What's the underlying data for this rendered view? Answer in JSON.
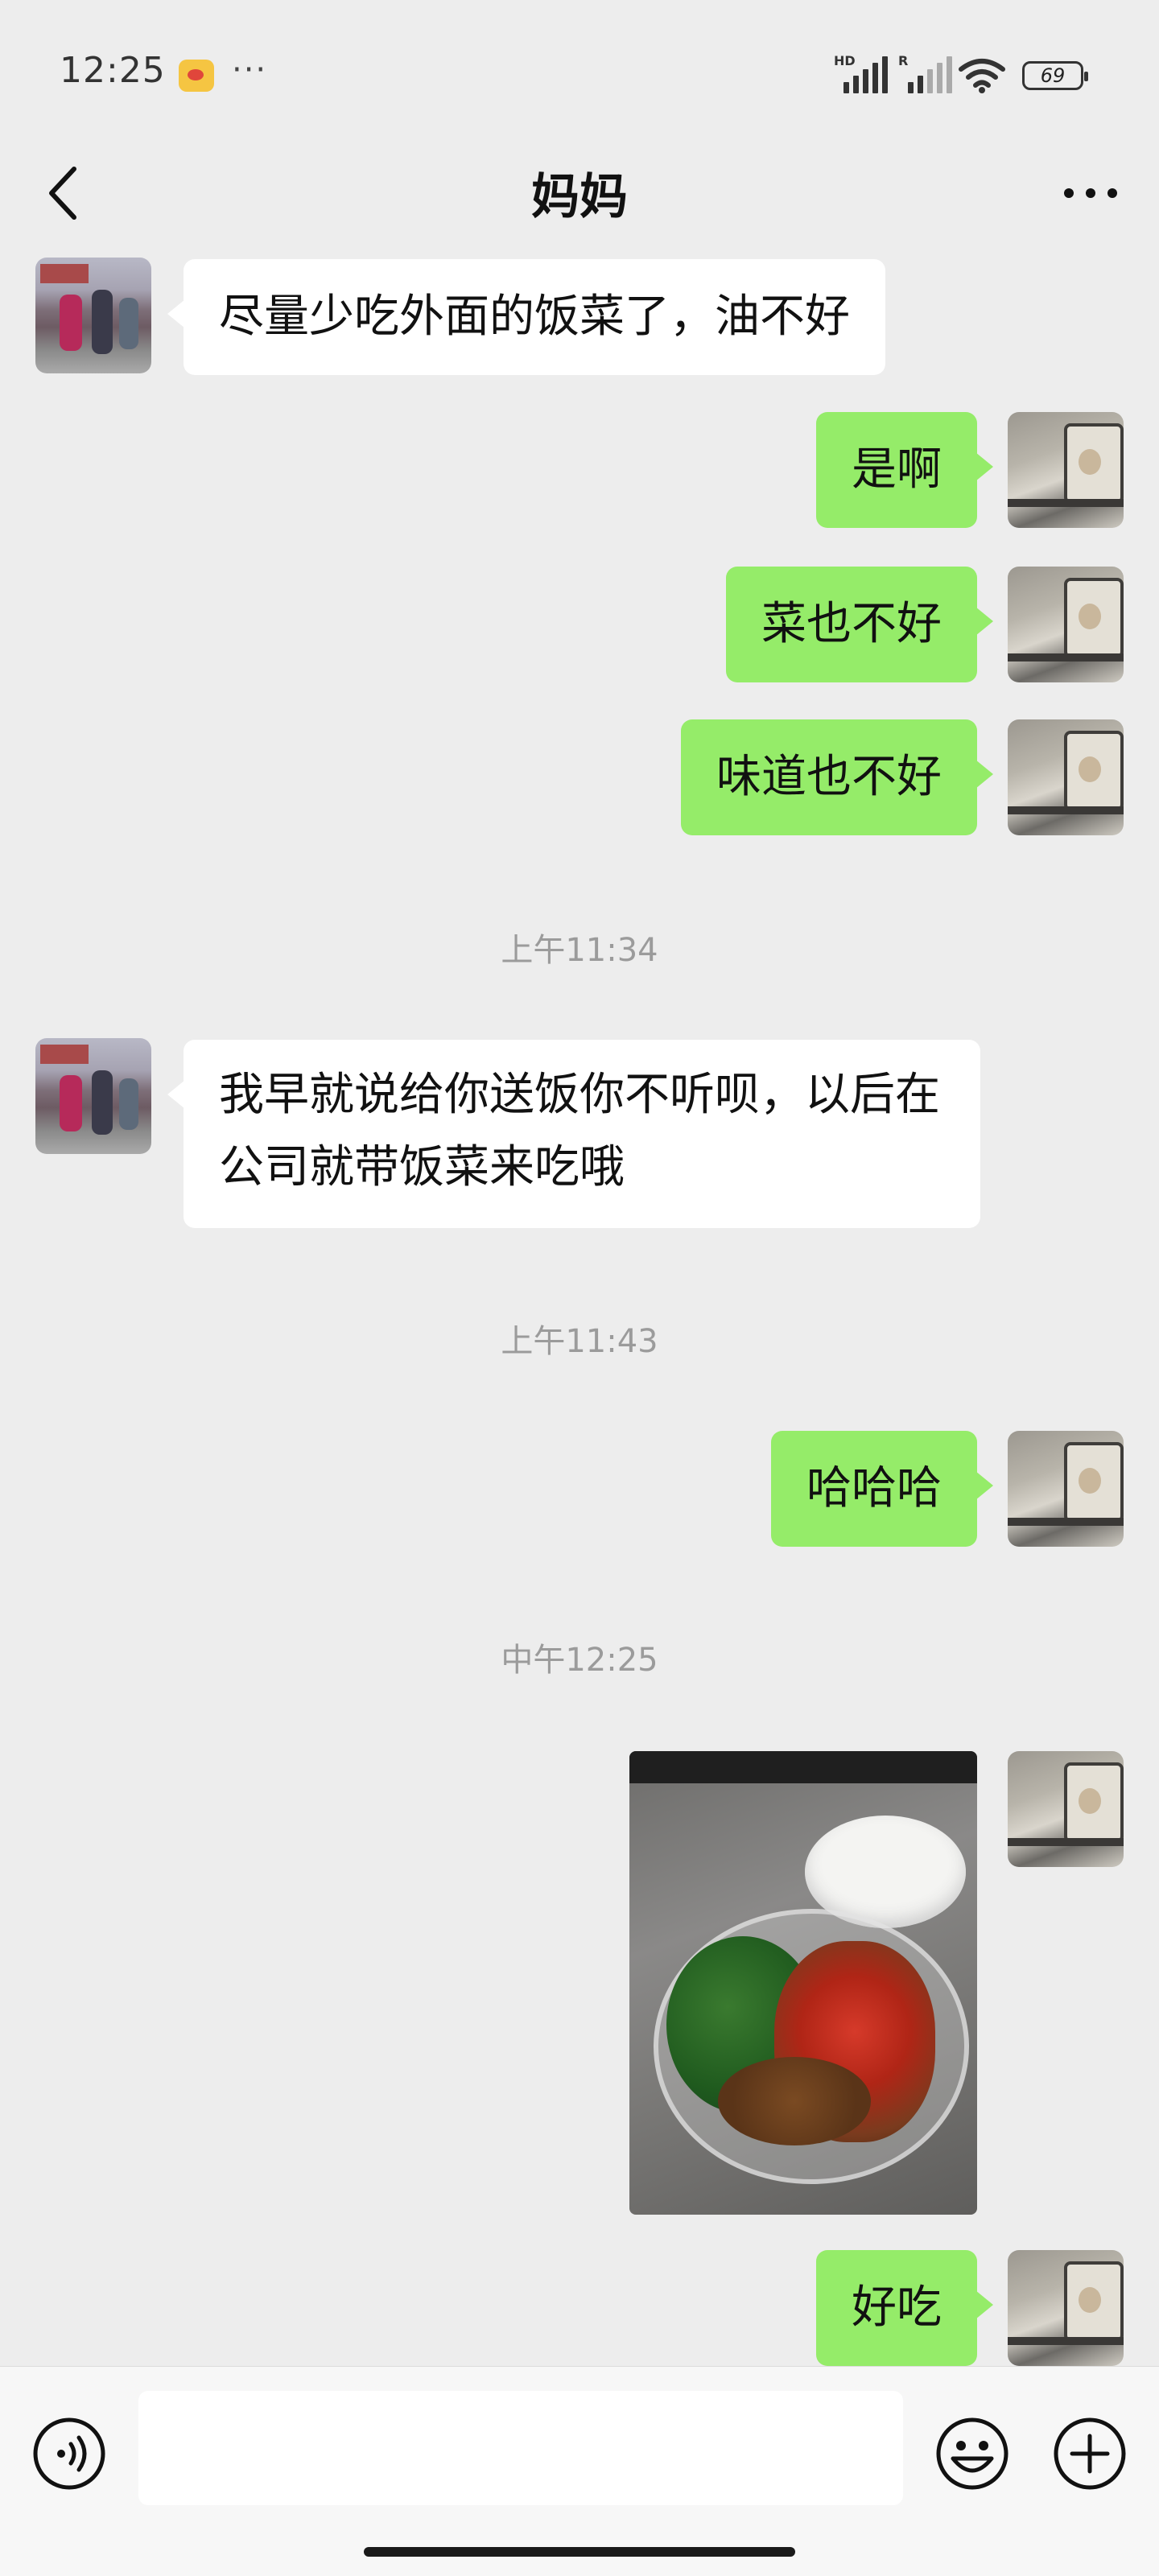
{
  "status_bar": {
    "time": "12:25",
    "more": "···",
    "signal1_tag": "HD",
    "signal2_tag": "R",
    "battery": "69"
  },
  "nav": {
    "title": "妈妈"
  },
  "messages": [
    {
      "side": "left",
      "text": "尽量少吃外面的饭菜了，油不好"
    },
    {
      "side": "right",
      "text": "是啊"
    },
    {
      "side": "right",
      "text": "菜也不好"
    },
    {
      "side": "right",
      "text": "味道也不好"
    },
    {
      "type": "time",
      "text": "上午11:34"
    },
    {
      "side": "left",
      "text": "我早就说给你送饭你不听呗，以后在公司就带饭菜来吃哦"
    },
    {
      "type": "time",
      "text": "上午11:43"
    },
    {
      "side": "right",
      "text": "哈哈哈"
    },
    {
      "type": "time",
      "text": "中午12:25"
    },
    {
      "side": "right",
      "type": "image",
      "image": "food-photo"
    },
    {
      "side": "right",
      "text": "好吃"
    }
  ],
  "input_bar": {
    "voice_icon": "voice-icon",
    "emoji_icon": "emoji-icon",
    "plus_icon": "plus-icon",
    "text_value": ""
  },
  "colors": {
    "background": "#ededed",
    "bubble_self": "#95ec69",
    "bubble_other": "#ffffff"
  }
}
